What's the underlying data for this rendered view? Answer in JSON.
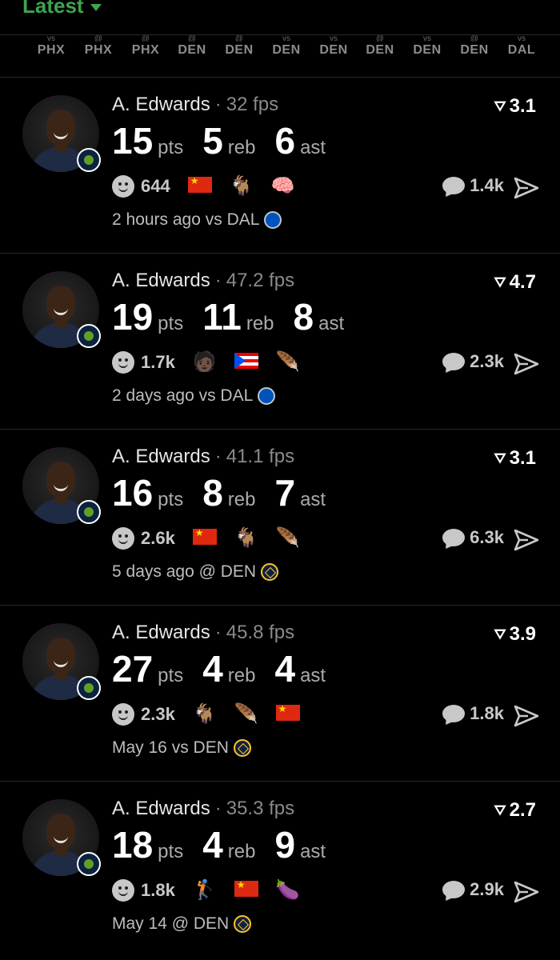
{
  "header": {
    "title": "Latest"
  },
  "schedule": [
    {
      "abbr": "PHX",
      "pre": "vs"
    },
    {
      "abbr": "PHX",
      "pre": "@"
    },
    {
      "abbr": "PHX",
      "pre": "@"
    },
    {
      "abbr": "DEN",
      "pre": "@"
    },
    {
      "abbr": "DEN",
      "pre": "@"
    },
    {
      "abbr": "DEN",
      "pre": "vs"
    },
    {
      "abbr": "DEN",
      "pre": "vs"
    },
    {
      "abbr": "DEN",
      "pre": "@"
    },
    {
      "abbr": "DEN",
      "pre": "vs"
    },
    {
      "abbr": "DEN",
      "pre": "@"
    },
    {
      "abbr": "DAL",
      "pre": "vs"
    }
  ],
  "cards": [
    {
      "player": "A. Edwards",
      "fps": "32 fps",
      "rating": "3.1",
      "pts": "15",
      "reb": "5",
      "ast": "6",
      "pts_label": "pts",
      "reb_label": "reb",
      "ast_label": "ast",
      "reactions": "644",
      "comments": "1.4k",
      "time": "2 hours ago vs DAL",
      "opponent": "DAL",
      "emojis": [
        "flag-cn",
        "🐐",
        "🧠"
      ]
    },
    {
      "player": "A. Edwards",
      "fps": "47.2 fps",
      "rating": "4.7",
      "pts": "19",
      "reb": "11",
      "ast": "8",
      "pts_label": "pts",
      "reb_label": "reb",
      "ast_label": "ast",
      "reactions": "1.7k",
      "comments": "2.3k",
      "time": "2 days ago vs DAL",
      "opponent": "DAL",
      "emojis": [
        "🧑🏿",
        "flag-pr",
        "🪶"
      ]
    },
    {
      "player": "A. Edwards",
      "fps": "41.1 fps",
      "rating": "3.1",
      "pts": "16",
      "reb": "8",
      "ast": "7",
      "pts_label": "pts",
      "reb_label": "reb",
      "ast_label": "ast",
      "reactions": "2.6k",
      "comments": "6.3k",
      "time": "5 days ago @ DEN",
      "opponent": "DEN",
      "emojis": [
        "flag-cn",
        "🐐",
        "🪶"
      ]
    },
    {
      "player": "A. Edwards",
      "fps": "45.8 fps",
      "rating": "3.9",
      "pts": "27",
      "reb": "4",
      "ast": "4",
      "pts_label": "pts",
      "reb_label": "reb",
      "ast_label": "ast",
      "reactions": "2.3k",
      "comments": "1.8k",
      "time": "May 16 vs DEN",
      "opponent": "DEN",
      "emojis": [
        "🐐",
        "🪶",
        "flag-cn"
      ]
    },
    {
      "player": "A. Edwards",
      "fps": "35.3 fps",
      "rating": "2.7",
      "pts": "18",
      "reb": "4",
      "ast": "9",
      "pts_label": "pts",
      "reb_label": "reb",
      "ast_label": "ast",
      "reactions": "1.8k",
      "comments": "2.9k",
      "time": "May 14 @ DEN",
      "opponent": "DEN",
      "emojis": [
        "🏌",
        "flag-cn",
        "🍆"
      ]
    }
  ]
}
